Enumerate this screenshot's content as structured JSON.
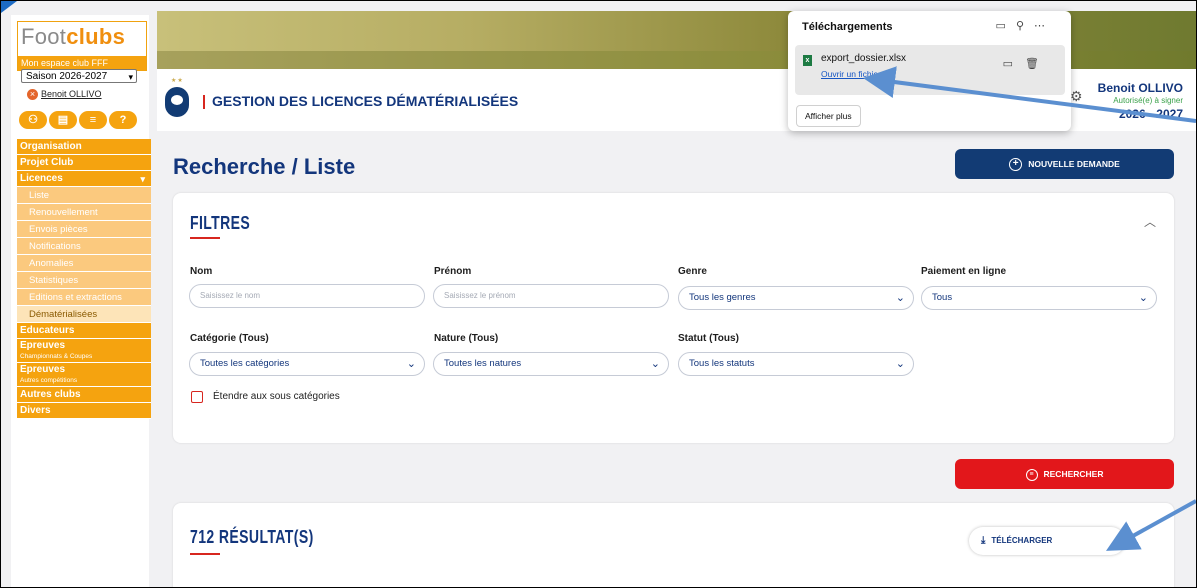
{
  "sidebar": {
    "logo_main": "Foot",
    "logo_accent": "clubs",
    "logo_tagline": "Mon espace club FFF",
    "season": "Saison 2026-2027",
    "user": "Benoit OLLIVO",
    "quick_icons": [
      "users-icon",
      "document-icon",
      "list-icon",
      "help-icon"
    ],
    "menu": [
      {
        "label": "Organisation",
        "type": "main"
      },
      {
        "label": "Projet Club",
        "type": "main"
      },
      {
        "label": "Licences",
        "type": "main",
        "expanded": true
      },
      {
        "label": "Liste",
        "type": "sub"
      },
      {
        "label": "Renouvellement",
        "type": "sub"
      },
      {
        "label": "Envois pièces",
        "type": "sub"
      },
      {
        "label": "Notifications",
        "type": "sub"
      },
      {
        "label": "Anomalies",
        "type": "sub"
      },
      {
        "label": "Statistiques",
        "type": "sub"
      },
      {
        "label": "Editions et extractions",
        "type": "sub"
      },
      {
        "label": "Dématérialisées",
        "type": "sub-active"
      },
      {
        "label": "Educateurs",
        "type": "main"
      },
      {
        "label": "Epreuves",
        "type": "main-two",
        "sub": "Championnats & Coupes"
      },
      {
        "label": "Epreuves",
        "type": "main-two",
        "sub": "Autres compétitions"
      },
      {
        "label": "Autres clubs",
        "type": "main"
      },
      {
        "label": "Divers",
        "type": "main"
      }
    ]
  },
  "header": {
    "title": "GESTION DES LICENCES DÉMATÉRIALISÉES",
    "user_name": "Benoit OLLIVO",
    "user_role": "Autorisé(e) à signer",
    "season": "2026 - 2027"
  },
  "main": {
    "page_title": "Recherche / Liste",
    "new_request_label": "NOUVELLE DEMANDE",
    "filters_title": "FILTRES",
    "filters": {
      "nom": {
        "label": "Nom",
        "placeholder": "Saisissez le nom"
      },
      "prenom": {
        "label": "Prénom",
        "placeholder": "Saisissez le prénom"
      },
      "genre": {
        "label": "Genre",
        "value": "Tous les genres"
      },
      "paiement": {
        "label": "Paiement en ligne",
        "value": "Tous"
      },
      "categorie": {
        "label": "Catégorie (Tous)",
        "value": "Toutes les catégories"
      },
      "nature": {
        "label": "Nature (Tous)",
        "value": "Toutes les natures"
      },
      "statut": {
        "label": "Statut (Tous)",
        "value": "Tous les statuts"
      },
      "extend_label": "Étendre aux sous catégories"
    },
    "search_label": "RECHERCHER",
    "results_title": "712 RÉSULTAT(S)",
    "download_label": "TÉLÉCHARGER"
  },
  "downloads": {
    "title": "Téléchargements",
    "file_name": "export_dossier.xlsx",
    "open_label": "Ouvrir un fichier",
    "more_label": "Afficher plus"
  },
  "colors": {
    "brand_navy": "#123b74",
    "brand_red": "#e2171b",
    "sidebar_orange": "#f5a30f"
  }
}
